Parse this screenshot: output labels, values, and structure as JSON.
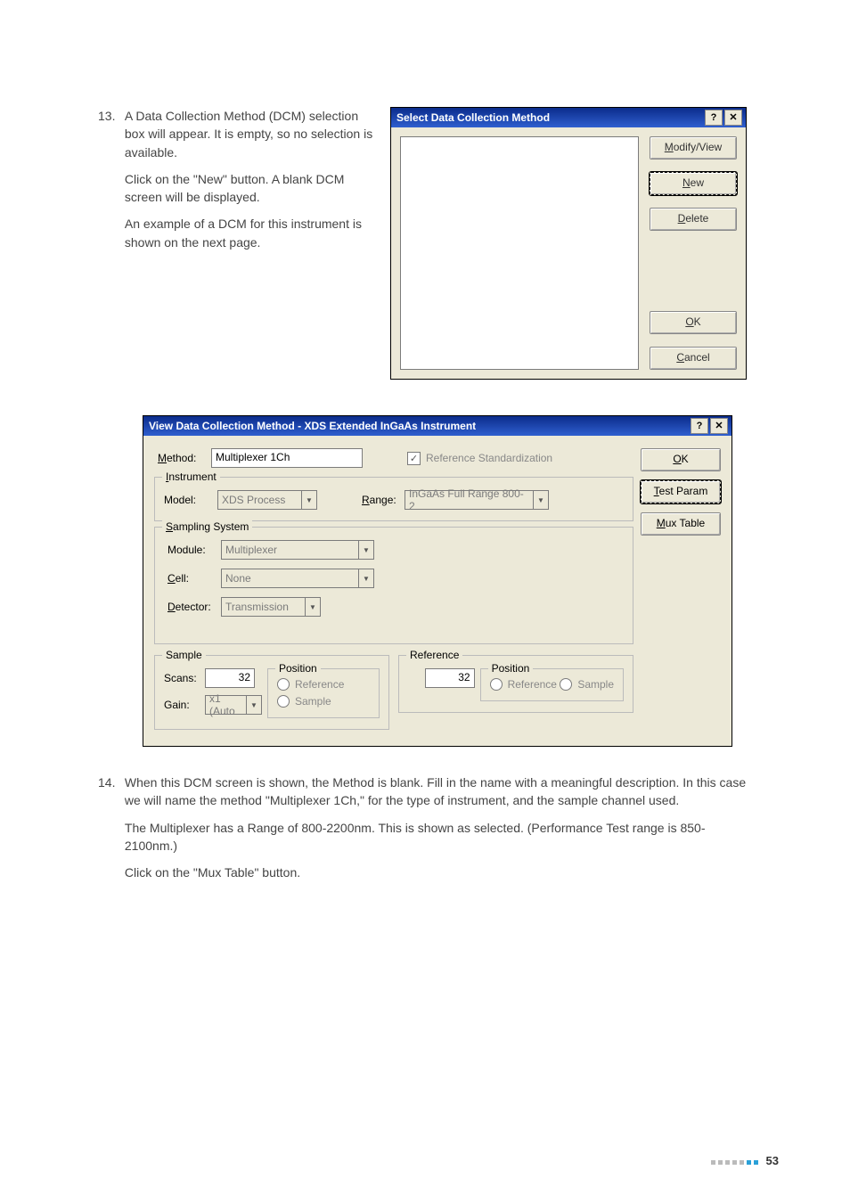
{
  "step13": {
    "number": "13.",
    "p1a": "A Data Collection Method (DCM) selection box will appear. It is empty, so no selection is available.",
    "p1b": "Click on the \"New\" button. A blank DCM screen will be displayed.",
    "p1c": "An example of a DCM for this instrument is shown on the next page."
  },
  "dlg1": {
    "title": "Select Data Collection Method",
    "buttons": {
      "modifyview_pre": "M",
      "modifyview_rest": "odify/View",
      "new_pre": "N",
      "new_rest": "ew",
      "delete_pre": "D",
      "delete_rest": "elete",
      "ok_pre": "O",
      "ok_rest": "K",
      "cancel_pre": "C",
      "cancel_rest": "ancel"
    }
  },
  "dlg2": {
    "title": "View Data Collection Method - XDS Extended InGaAs Instrument",
    "method_lbl_pre": "M",
    "method_lbl_rest": "ethod:",
    "method_value": "Multiplexer 1Ch",
    "refstd_label": "Reference Standardization",
    "instrument_legend_pre": "I",
    "instrument_legend_rest": "nstrument",
    "model_lbl": "Model:",
    "model_value": "XDS Process",
    "range_lbl_pre": "R",
    "range_lbl_rest": "ange:",
    "range_value": "InGaAs Full Range 800-2",
    "sampling_legend_pre": "S",
    "sampling_legend_rest": "ampling System",
    "module_lbl": "Module:",
    "module_value": "Multiplexer",
    "cell_lbl_pre": "C",
    "cell_lbl_rest": "ell:",
    "cell_value": "None",
    "detector_lbl_pre": "D",
    "detector_lbl_rest": "etector:",
    "detector_value": "Transmission",
    "sample_legend": "Sample",
    "reference_legend": "Reference",
    "position_legend": "Position",
    "scans_lbl": "Scans:",
    "scans_value": "32",
    "ref_scans_value": "32",
    "gain_lbl": "Gain:",
    "gain_value": "x1 (Auto",
    "radio_reference": "Reference",
    "radio_sample": "Sample",
    "btn_ok_pre": "O",
    "btn_ok_rest": "K",
    "btn_test_pre": "T",
    "btn_test_rest": "est Param",
    "btn_mux_pre": "M",
    "btn_mux_rest": "ux Table"
  },
  "step14": {
    "number": "14.",
    "p1": "When this DCM screen is shown, the Method is blank. Fill in the name with a meaningful description. In this case we will name the method \"Multiplexer 1Ch,\" for the type of instrument, and the sample channel used.",
    "p2": "The Multiplexer has a Range of 800-2200nm. This is shown as selected. (Performance Test range is 850-2100nm.)",
    "p3": "Click on the \"Mux Table\" button."
  },
  "footer": {
    "page": "53"
  }
}
